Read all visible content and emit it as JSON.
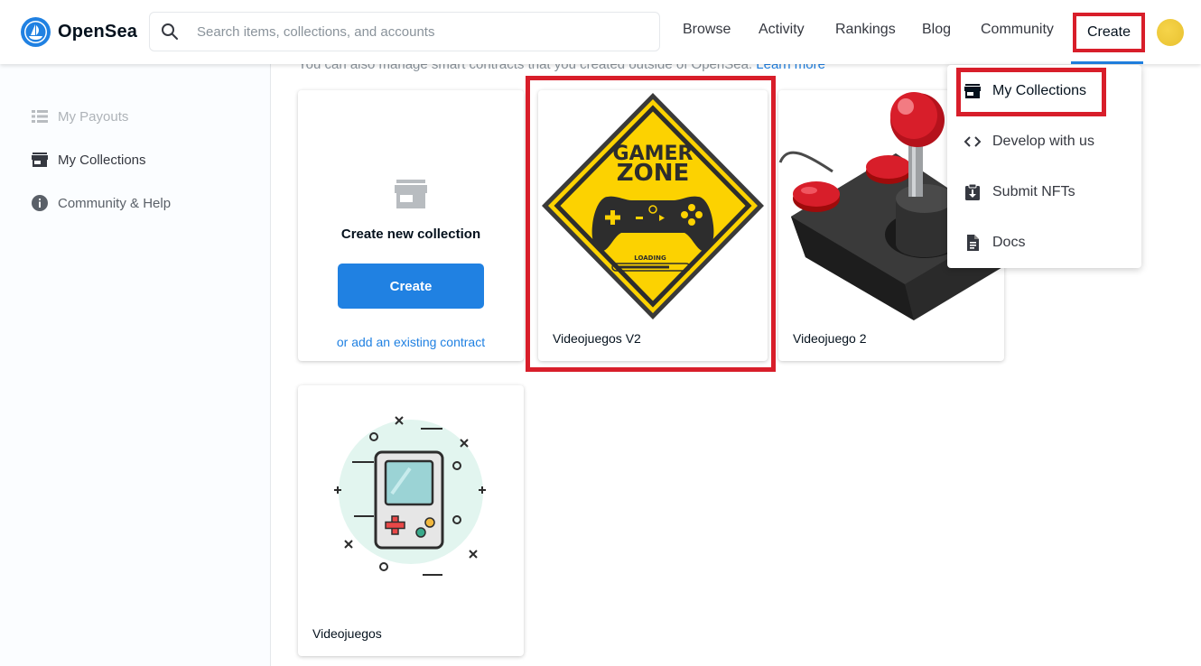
{
  "header": {
    "logo_text": "OpenSea",
    "search_placeholder": "Search items, collections, and accounts",
    "nav": {
      "browse": "Browse",
      "activity": "Activity",
      "rankings": "Rankings",
      "blog": "Blog",
      "community": "Community",
      "create": "Create"
    }
  },
  "sidebar": {
    "items": [
      {
        "label": "My Payouts",
        "icon": "list-icon"
      },
      {
        "label": "My Collections",
        "icon": "store-icon"
      },
      {
        "label": "Community & Help",
        "icon": "info-icon"
      }
    ]
  },
  "main": {
    "top_text": "You can also manage smart contracts that you created outside of OpenSea.",
    "top_link": "Learn more",
    "create_card": {
      "title": "Create new collection",
      "button": "Create",
      "link": "or add an existing contract"
    },
    "collections": [
      {
        "name": "Videojuegos V2"
      },
      {
        "name": "Videojuego 2"
      },
      {
        "name": "Videojuegos"
      }
    ],
    "gamer_sign": {
      "line1": "GAMER",
      "line2": "ZONE",
      "loading": "LOADING"
    }
  },
  "dropdown": {
    "items": [
      {
        "label": "My Collections",
        "icon": "store-icon"
      },
      {
        "label": "Develop with us",
        "icon": "code-icon"
      },
      {
        "label": "Submit NFTs",
        "icon": "clipboard-download-icon"
      },
      {
        "label": "Docs",
        "icon": "document-icon"
      }
    ]
  },
  "colors": {
    "accent": "#2081e2",
    "highlight": "#d81e2a",
    "sign_yellow": "#fcd201"
  }
}
